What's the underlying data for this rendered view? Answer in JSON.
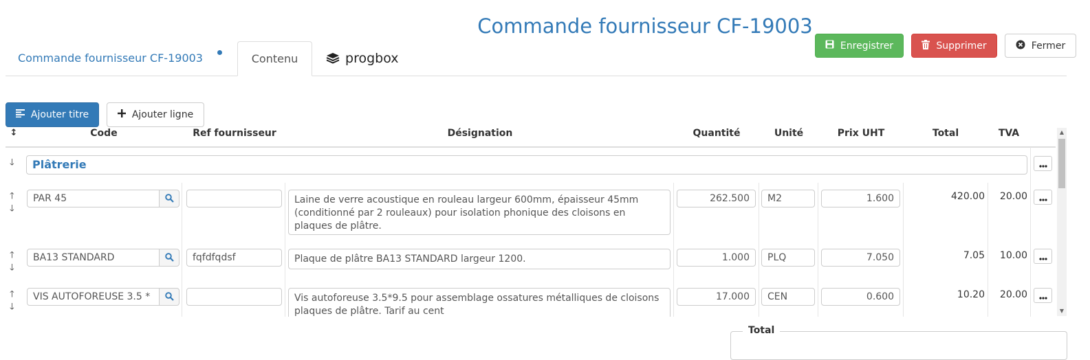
{
  "page_title": "Commande fournisseur CF-19003",
  "tabs": {
    "main": "Commande fournisseur CF-19003",
    "content": "Contenu",
    "progbox": "progbox"
  },
  "actions": {
    "save": "Enregistrer",
    "delete": "Supprimer",
    "close": "Fermer"
  },
  "toolbar": {
    "add_title": "Ajouter titre",
    "add_line": "Ajouter ligne"
  },
  "columns": {
    "code": "Code",
    "supplier_ref": "Ref fournisseur",
    "designation": "Désignation",
    "quantity": "Quantité",
    "unit": "Unité",
    "price": "Prix UHT",
    "total": "Total",
    "vat": "TVA"
  },
  "section_title": "Plâtrerie",
  "rows": [
    {
      "code": "PAR 45",
      "supplier_ref": "",
      "designation": "Laine de verre acoustique en rouleau largeur 600mm, épaisseur 45mm (conditionné par 2 rouleaux) pour isolation phonique des cloisons en plaques de plâtre.",
      "quantity": "262.500",
      "unit": "M2",
      "price": "1.600",
      "total": "420.00",
      "vat": "20.00"
    },
    {
      "code": "BA13 STANDARD",
      "supplier_ref": "fqfdfqdsf",
      "designation": "Plaque de plâtre BA13 STANDARD largeur 1200.",
      "quantity": "1.000",
      "unit": "PLQ",
      "price": "7.050",
      "total": "7.05",
      "vat": "10.00"
    },
    {
      "code": "VIS AUTOFOREUSE 3.5 *",
      "supplier_ref": "",
      "designation": "Vis autoforeuse 3.5*9.5 pour assemblage ossatures métalliques de cloisons plaques de plâtre. Tarif au cent",
      "quantity": "17.000",
      "unit": "CEN",
      "price": "0.600",
      "total": "10.20",
      "vat": "20.00"
    }
  ],
  "totals_legend": "Total",
  "colors": {
    "primary": "#337ab7",
    "success": "#5cb85c",
    "danger": "#d9534f"
  }
}
